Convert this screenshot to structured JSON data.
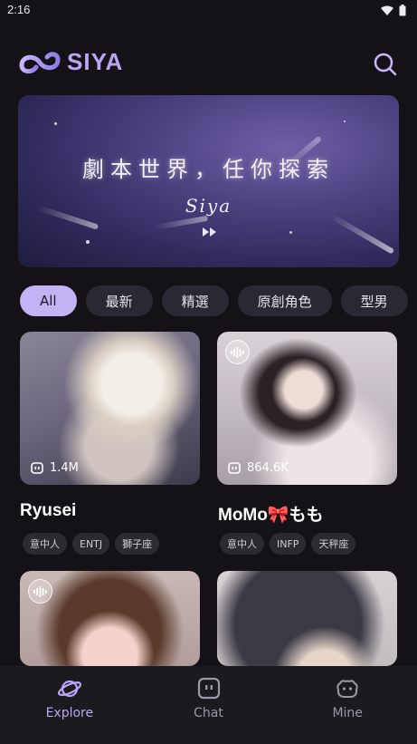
{
  "status_bar": {
    "time": "2:16"
  },
  "app": {
    "logo_text": "SIYA"
  },
  "banner": {
    "title": "劇本世界，任你探索",
    "subtitle": "Siya"
  },
  "chips": [
    "All",
    "最新",
    "精選",
    "原創角色",
    "型男"
  ],
  "active_chip": "All",
  "cards": [
    {
      "name": "Ryusei",
      "stat": "1.4M",
      "tags": [
        "意中人",
        "ENTJ",
        "獅子座"
      ],
      "voice": false
    },
    {
      "name": "MoMo🎀もも",
      "stat": "864.6K",
      "tags": [
        "意中人",
        "INFP",
        "天秤座"
      ],
      "voice": true
    },
    {
      "name": "",
      "stat": "",
      "tags": [],
      "voice": true
    },
    {
      "name": "",
      "stat": "",
      "tags": [],
      "voice": false
    }
  ],
  "nav": [
    {
      "label": "Explore",
      "icon": "planet-icon",
      "active": true
    },
    {
      "label": "Chat",
      "icon": "chat-icon",
      "active": false
    },
    {
      "label": "Mine",
      "icon": "mine-icon",
      "active": false
    }
  ],
  "colors": {
    "accent": "#b9a6f5",
    "chip_active": "#c2b3f4",
    "background": "#141217"
  }
}
